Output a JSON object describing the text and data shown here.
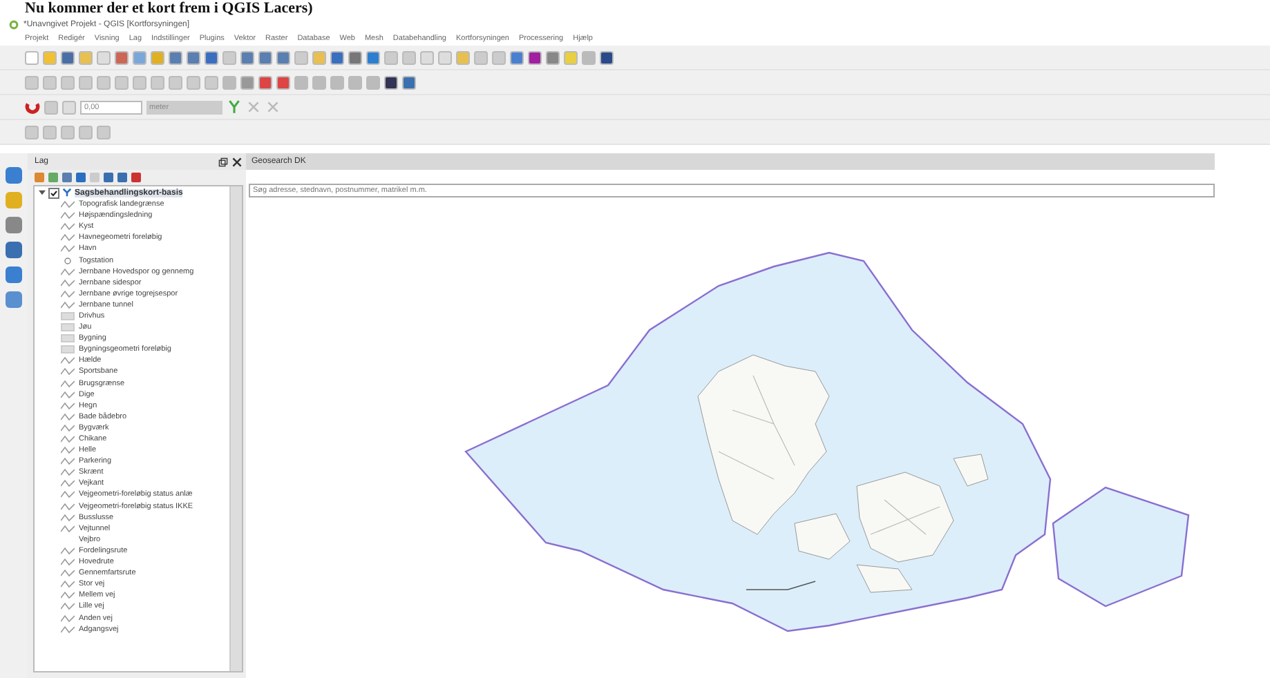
{
  "heading": "Nu kommer der et kort frem i QGIS Lacers)",
  "window": {
    "title": "*Unavngivet Projekt - QGIS [Kortforsyningen]"
  },
  "menu": [
    "Projekt",
    "Redigér",
    "Visning",
    "Lag",
    "Indstillinger",
    "Plugins",
    "Vektor",
    "Raster",
    "Database",
    "Web",
    "Mesh",
    "Databehandling",
    "Kortforsyningen",
    "Processering",
    "Hjælp"
  ],
  "snapping_toolbar": {
    "tolerance": "0,00",
    "unit": "meter"
  },
  "layers_panel": {
    "title": "Lag",
    "tree": [
      {
        "name": "Sagsbehandlingskort-basis",
        "checked": true,
        "expanded": true,
        "children": [
          {
            "name": "Topografisk landegrænse",
            "kind": "line"
          },
          {
            "name": "Højspændingsledning",
            "kind": "line"
          },
          {
            "name": "Kyst",
            "kind": "line"
          },
          {
            "name": "Havnegeometri foreløbig",
            "kind": "line"
          },
          {
            "name": "Havn",
            "kind": "line"
          },
          {
            "name": "Togstation",
            "kind": "point"
          },
          {
            "name": "Jernbane Hovedspor og gennemg",
            "kind": "line"
          },
          {
            "name": "Jernbane sidespor",
            "kind": "line"
          },
          {
            "name": "Jernbane øvrige togrejsespor",
            "kind": "line"
          },
          {
            "name": "Jernbane tunnel",
            "kind": "line"
          },
          {
            "name": "Drivhus",
            "kind": "fill"
          },
          {
            "name": "Jøu",
            "kind": "fill"
          },
          {
            "name": "Bygning",
            "kind": "fill"
          },
          {
            "name": "Bygningsgeometri foreløbig",
            "kind": "fill"
          },
          {
            "name": "Hælde",
            "kind": "line"
          },
          {
            "name": "Sportsbane",
            "kind": "line"
          },
          {
            "name": "Brugsgrænse",
            "kind": "line"
          },
          {
            "name": "Dige",
            "kind": "line"
          },
          {
            "name": "Hegn",
            "kind": "line"
          },
          {
            "name": "Bade bådebro",
            "kind": "line"
          },
          {
            "name": "Bygværk",
            "kind": "line"
          },
          {
            "name": "Chikane",
            "kind": "line"
          },
          {
            "name": "Helle",
            "kind": "line"
          },
          {
            "name": "Parkering",
            "kind": "line"
          },
          {
            "name": "Skrænt",
            "kind": "line"
          },
          {
            "name": "Vejkant",
            "kind": "line"
          },
          {
            "name": "Vejgeometri-foreløbig status anlæ",
            "kind": "line"
          },
          {
            "name": "Vejgeometri-foreløbig status IKKE",
            "kind": "line"
          },
          {
            "name": "Busslusse",
            "kind": "line"
          },
          {
            "name": "Vejtunnel",
            "kind": "line"
          },
          {
            "name": "Vejbro",
            "kind": "blank"
          },
          {
            "name": "Fordelingsrute",
            "kind": "line"
          },
          {
            "name": "Hovedrute",
            "kind": "line"
          },
          {
            "name": "Gennemfartsrute",
            "kind": "line"
          },
          {
            "name": "Stor vej",
            "kind": "line"
          },
          {
            "name": "Mellem vej",
            "kind": "line"
          },
          {
            "name": "Lille vej",
            "kind": "line"
          },
          {
            "name": "Anden vej",
            "kind": "line"
          },
          {
            "name": "Adgangsvej",
            "kind": "line"
          }
        ]
      }
    ]
  },
  "geosearch": {
    "title": "Geosearch DK",
    "placeholder": "Søg adresse, stednavn, postnummer, matrikel m.m."
  }
}
